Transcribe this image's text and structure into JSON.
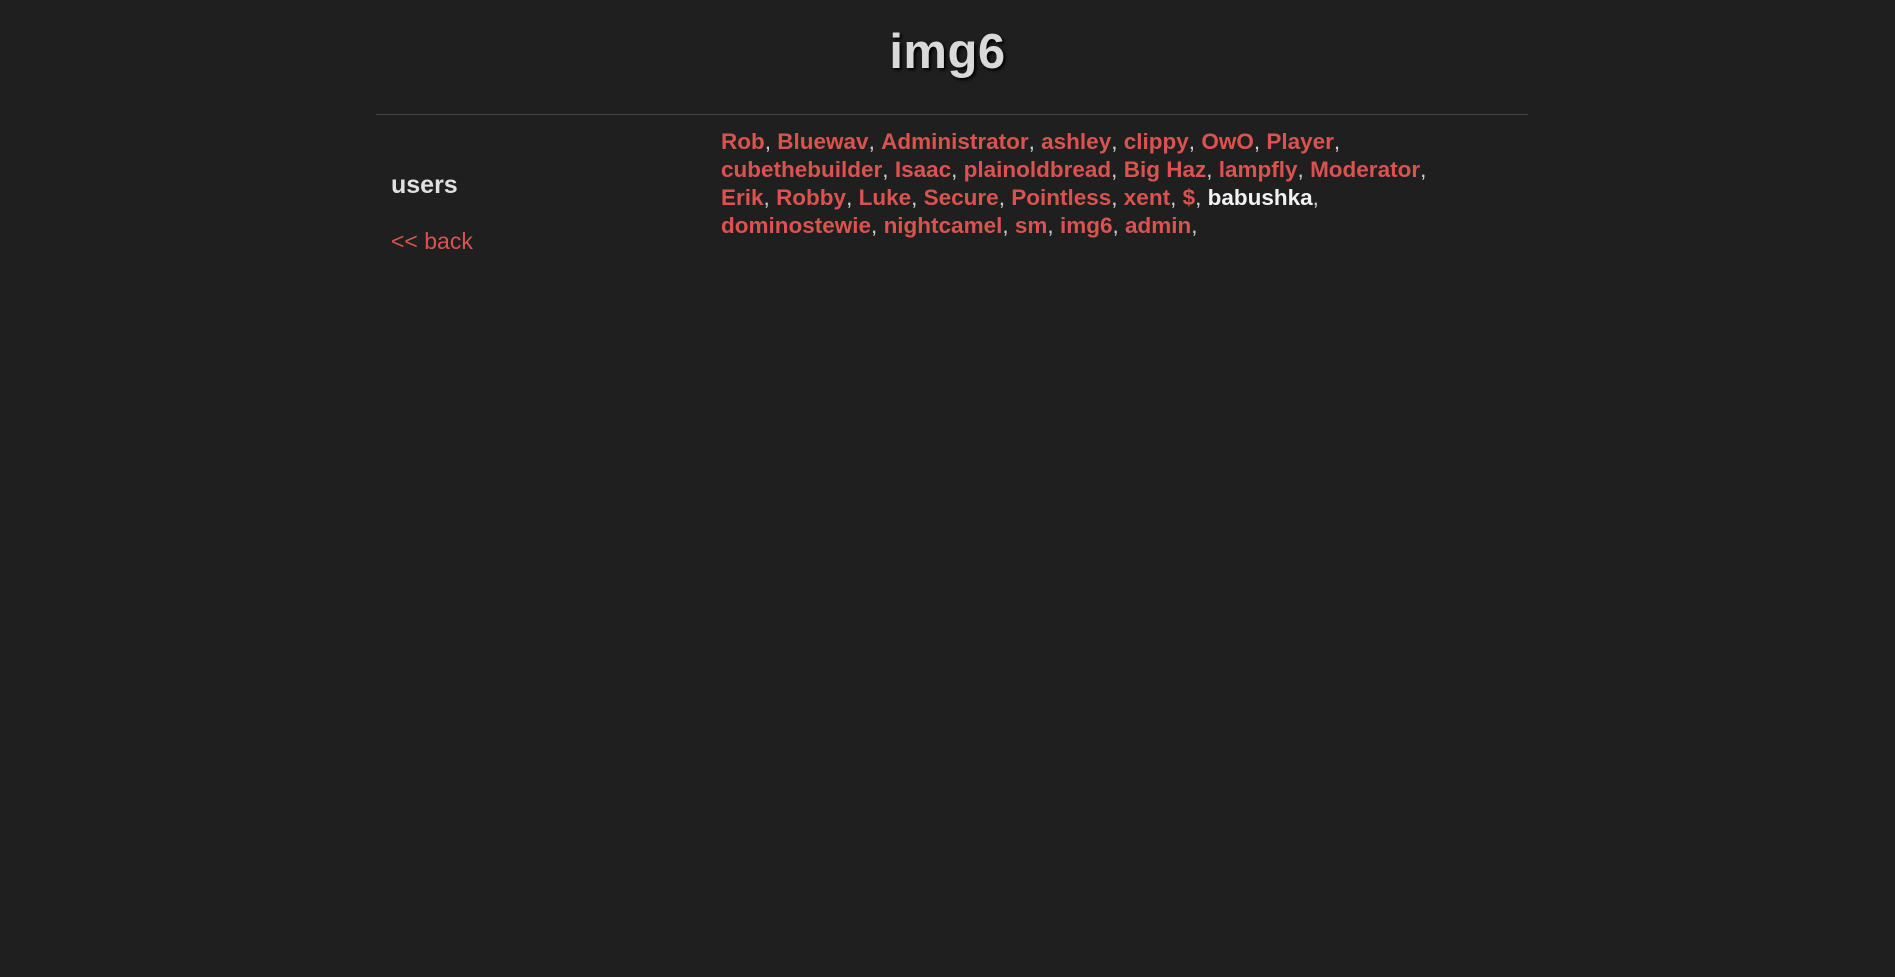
{
  "site": {
    "title": "img6"
  },
  "sidebar": {
    "section_title": "users",
    "back_label": "<< back"
  },
  "users": [
    {
      "name": "Rob",
      "current": false
    },
    {
      "name": "Bluewav",
      "current": false
    },
    {
      "name": "Administrator",
      "current": false
    },
    {
      "name": "ashley",
      "current": false
    },
    {
      "name": "clippy",
      "current": false
    },
    {
      "name": "OwO",
      "current": false
    },
    {
      "name": "Player",
      "current": false
    },
    {
      "name": "cubethebuilder",
      "current": false
    },
    {
      "name": "Isaac",
      "current": false
    },
    {
      "name": "plainoldbread",
      "current": false
    },
    {
      "name": "Big Haz",
      "current": false
    },
    {
      "name": "lampfly",
      "current": false
    },
    {
      "name": "Moderator",
      "current": false
    },
    {
      "name": "Erik",
      "current": false
    },
    {
      "name": "Robby",
      "current": false
    },
    {
      "name": "Luke",
      "current": false
    },
    {
      "name": "Secure",
      "current": false
    },
    {
      "name": "Pointless",
      "current": false
    },
    {
      "name": "xent",
      "current": false
    },
    {
      "name": "$",
      "current": false
    },
    {
      "name": "babushka",
      "current": true
    },
    {
      "name": "dominostewie",
      "current": false
    },
    {
      "name": "nightcamel",
      "current": false
    },
    {
      "name": "sm",
      "current": false
    },
    {
      "name": "img6",
      "current": false
    },
    {
      "name": "admin",
      "current": false
    }
  ],
  "separator": ",",
  "colors": {
    "background": "#1f1f1f",
    "link": "#d9534f",
    "current_user": "#f2f2f2",
    "heading": "#d9d9d9"
  }
}
